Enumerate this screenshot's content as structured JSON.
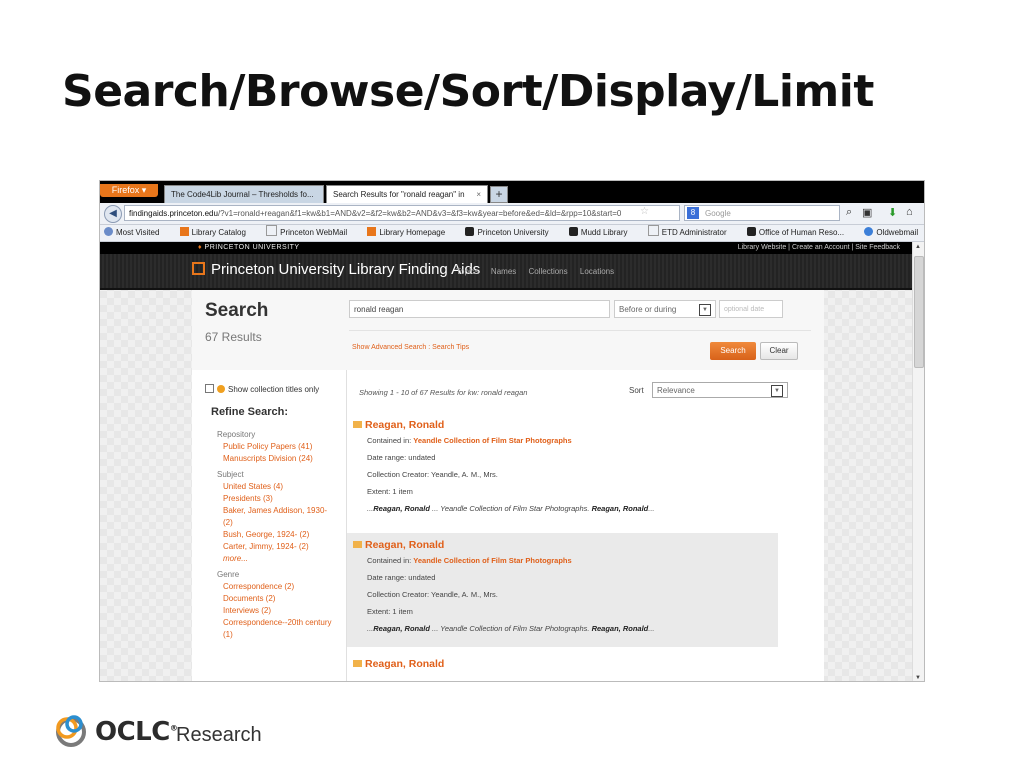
{
  "slide": {
    "title": "Search/Browse/Sort/Display/Limit",
    "logo": {
      "brand": "OCLC",
      "suffix": "Research",
      "reg": "®"
    }
  },
  "browser": {
    "menu_label": "Firefox",
    "tabs": [
      {
        "label": "The Code4Lib Journal – Thresholds fo..."
      },
      {
        "label": "Search Results for \"ronald reagan\" in"
      }
    ],
    "url_domain": "findingaids.princeton.edu",
    "url_prefix": "",
    "url_rest": "/?v1=ronald+reagan&f1=kw&b1=AND&v2=&f2=kw&b2=AND&v3=&f3=kw&year=before&ed=&ld=&rpp=10&start=0",
    "search_placeholder": "Google",
    "bookmarks": [
      "Most Visited",
      "Library Catalog",
      "Princeton WebMail",
      "Library Homepage",
      "Princeton University",
      "Mudd Library",
      "ETD Administrator",
      "Office of Human Reso...",
      "Oldwebmail"
    ]
  },
  "site": {
    "university": "PRINCETON UNIVERSITY",
    "top_links": "Library Website | Create an Account | Site Feedback",
    "title": "Princeton University Library Finding Aids",
    "nav": [
      "Topics",
      "Names",
      "Collections",
      "Locations"
    ]
  },
  "search": {
    "heading": "Search",
    "results_count": "67 Results",
    "query": "ronald reagan",
    "date_mode": "Before or during",
    "date_placeholder": "optional date",
    "links": "Show Advanced Search : Search Tips",
    "search_button": "Search",
    "clear_button": "Clear"
  },
  "sidebar": {
    "collection_option": "Show collection titles only",
    "refine_title": "Refine Search:",
    "facets": [
      {
        "heading": "Repository",
        "items": [
          "Public Policy Papers (41)",
          "Manuscripts Division (24)"
        ]
      },
      {
        "heading": "Subject",
        "items": [
          "United States (4)",
          "Presidents (3)",
          "Baker, James Addison, 1930- (2)",
          "Bush, George, 1924- (2)",
          "Carter, Jimmy, 1924- (2)"
        ],
        "more": "more..."
      },
      {
        "heading": "Genre",
        "items": [
          "Correspondence (2)",
          "Documents (2)",
          "Interviews (2)",
          "Correspondence--20th century (1)"
        ]
      }
    ]
  },
  "results": {
    "showing": "Showing 1 - 10 of 67 Results for kw: ronald reagan",
    "sort_label": "Sort",
    "sort_value": "Relevance",
    "items": [
      {
        "title": "Reagan, Ronald",
        "contained_label": "Contained in:",
        "contained_in": "Yeandle Collection of Film Star Photographs",
        "date_range": "Date range: undated",
        "creator": "Collection Creator: Yeandle, A. M., Mrs.",
        "extent": "Extent: 1 item",
        "snippet_pre": "...",
        "snippet_b1": "Reagan, Ronald",
        "snippet_mid": " ... Yeandle Collection of Film Star Photographs. ",
        "snippet_b2": "Reagan, Ronald",
        "snippet_post": "..."
      },
      {
        "title": "Reagan, Ronald",
        "contained_label": "Contained in:",
        "contained_in": "Yeandle Collection of Film Star Photographs",
        "date_range": "Date range: undated",
        "creator": "Collection Creator: Yeandle, A. M., Mrs.",
        "extent": "Extent: 1 item",
        "snippet_pre": "...",
        "snippet_b1": "Reagan, Ronald",
        "snippet_mid": " ... Yeandle Collection of Film Star Photographs. ",
        "snippet_b2": "Reagan, Ronald",
        "snippet_post": "..."
      },
      {
        "title": "Reagan, Ronald"
      }
    ]
  },
  "colors": {
    "accent": "#e0601a",
    "header_bg": "#2a2a2a"
  }
}
